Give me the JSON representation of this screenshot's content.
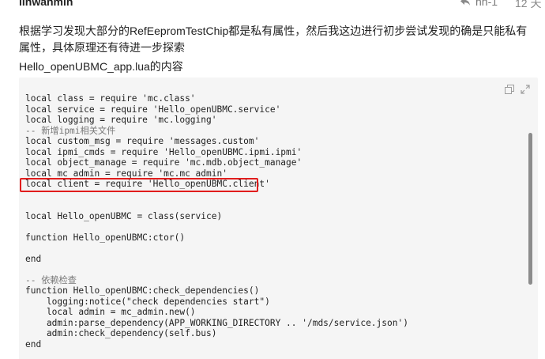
{
  "post": {
    "author": "linwanmin",
    "reply_to": "hh-1",
    "time": "12 天",
    "paragraph1": "根据学习发现大部分的RefEepromTestChip都是私有属性，然后我这边进行初步尝试发现的确是只能私有属性，具体原理还有待进一步探索",
    "paragraph2": "Hello_openUBMC_app.lua的内容"
  },
  "code": {
    "lines": [
      {
        "text": "local class = require 'mc.class'",
        "type": "code"
      },
      {
        "text": "local service = require 'Hello_openUBMC.service'",
        "type": "code"
      },
      {
        "text": "local logging = require 'mc.logging'",
        "type": "code"
      },
      {
        "text": "-- 新增ipmi相关文件",
        "type": "comment"
      },
      {
        "text": "local custom_msg = require 'messages.custom'",
        "type": "code"
      },
      {
        "text": "local ipmi_cmds = require 'Hello_openUBMC.ipmi.ipmi'",
        "type": "code"
      },
      {
        "text": "local object_manage = require 'mc.mdb.object_manage'",
        "type": "code"
      },
      {
        "text": "local mc_admin = require 'mc.mc_admin'",
        "type": "code"
      },
      {
        "text": "local client = require 'Hello_openUBMC.client'",
        "type": "code"
      },
      {
        "text": "",
        "type": "code"
      },
      {
        "text": "",
        "type": "code"
      },
      {
        "text": "local Hello_openUBMC = class(service)",
        "type": "code"
      },
      {
        "text": "",
        "type": "code"
      },
      {
        "text": "function Hello_openUBMC:ctor()",
        "type": "code"
      },
      {
        "text": "",
        "type": "code"
      },
      {
        "text": "end",
        "type": "code"
      },
      {
        "text": "",
        "type": "code"
      },
      {
        "text": "-- 依赖检查",
        "type": "comment"
      },
      {
        "text": "function Hello_openUBMC:check_dependencies()",
        "type": "code"
      },
      {
        "text": "    logging:notice(\"check dependencies start\")",
        "type": "code"
      },
      {
        "text": "    local admin = mc_admin.new()",
        "type": "code"
      },
      {
        "text": "    admin:parse_dependency(APP_WORKING_DIRECTORY .. '/mds/service.json')",
        "type": "code"
      },
      {
        "text": "    admin:check_dependency(self.bus)",
        "type": "code"
      },
      {
        "text": "end",
        "type": "code"
      }
    ]
  },
  "icons": {
    "reply": "reply-arrow-icon",
    "copy": "copy-icon",
    "expand": "fullscreen-icon"
  },
  "colors": {
    "highlight_border": "#e11d1d",
    "code_bg": "#f5f5f5"
  }
}
